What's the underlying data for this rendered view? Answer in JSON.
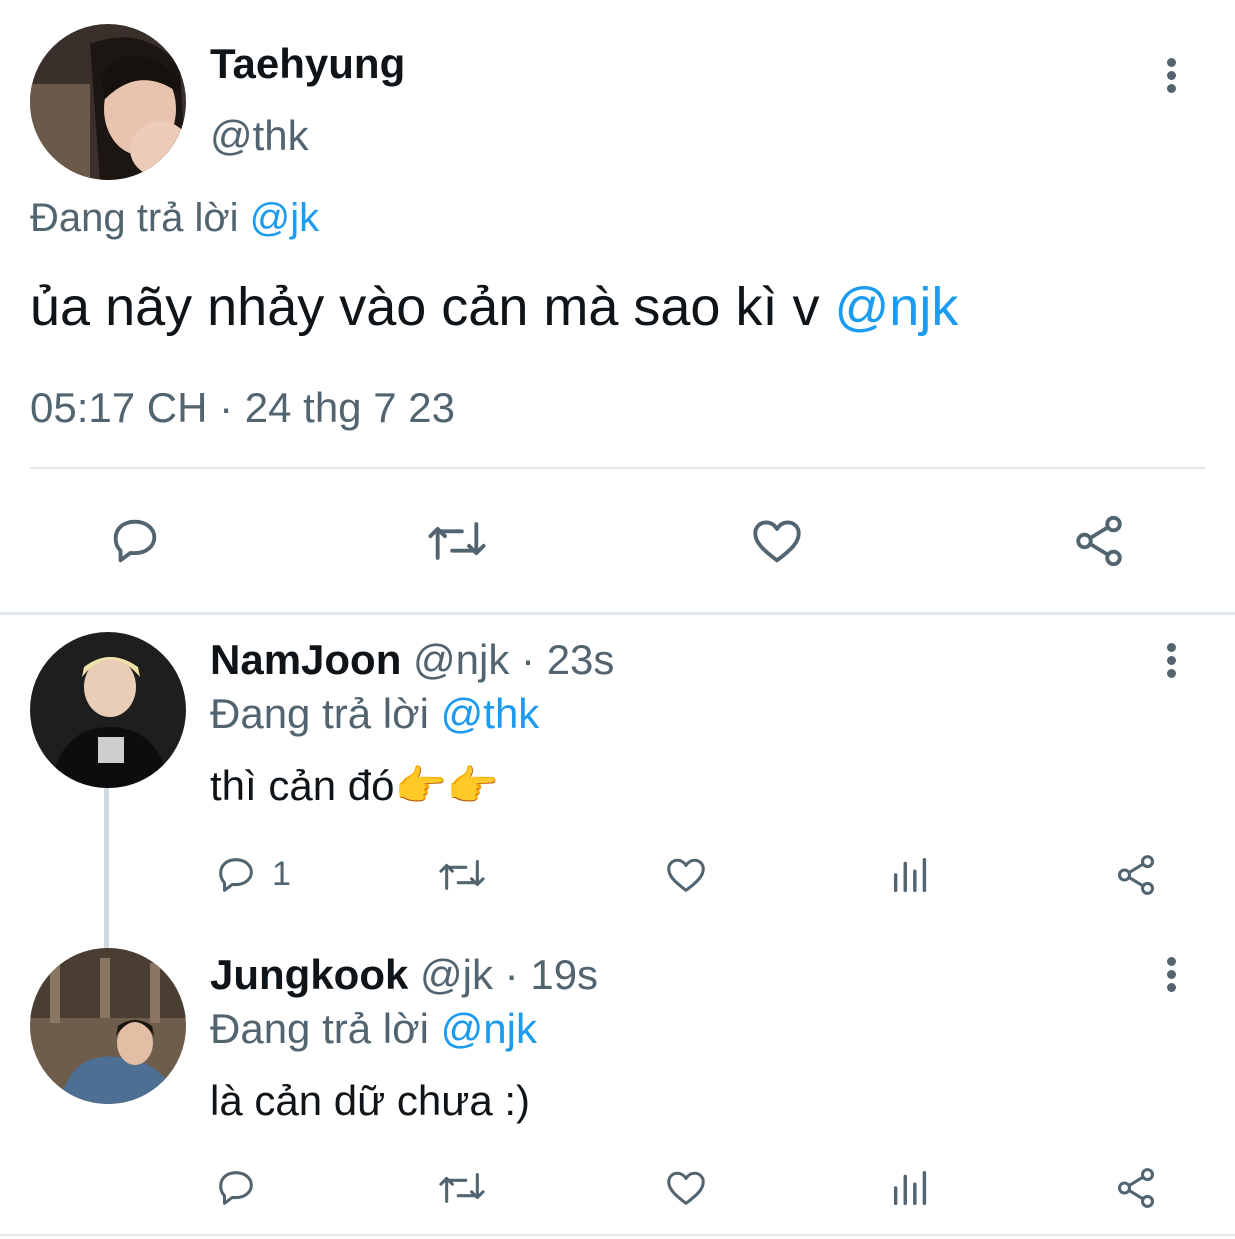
{
  "main_tweet": {
    "author_name": "Taehyung",
    "author_handle": "@thk",
    "reply_prefix": "Đang trả lời",
    "reply_to": "@jk",
    "text": "ủa nãy nhảy vào cản mà sao kì v",
    "text_mention": "@njk",
    "timestamp": "05:17 CH · 24 thg 7 23",
    "actions": [
      "reply-icon",
      "retweet-icon",
      "like-icon",
      "share-icon"
    ]
  },
  "replies": [
    {
      "author_name": "NamJoon",
      "author_handle": "@njk",
      "separator": "·",
      "time": "23s",
      "reply_prefix": "Đang trả lời",
      "reply_to": "@thk",
      "text": "thì cản đó👉👉",
      "reply_count": "1"
    },
    {
      "author_name": "Jungkook",
      "author_handle": "@jk",
      "separator": "·",
      "time": "19s",
      "reply_prefix": "Đang trả lời",
      "reply_to": "@njk",
      "text": "là cản dữ chưa :)",
      "reply_count": ""
    }
  ],
  "colors": {
    "link": "#1d9bf0",
    "muted": "#536471",
    "text": "#0f1419",
    "divider": "#e1e8ed"
  }
}
